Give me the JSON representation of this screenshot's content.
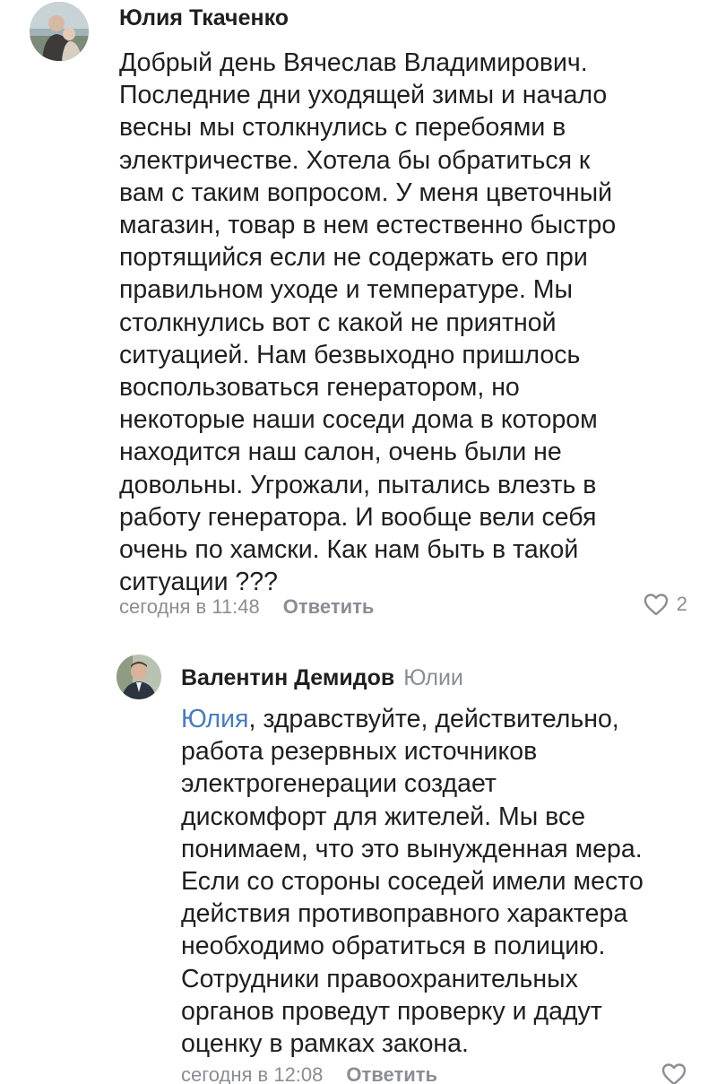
{
  "comment": {
    "author": "Юлия Ткаченко",
    "lines": [
      "Добрый день Вячеслав Владимирович.",
      "Последние дни уходящей зимы и начало",
      "весны мы столкнулись с перебоями в",
      "электричестве. Хотела бы обратиться к",
      "вам с таким вопросом. У меня цветочный",
      "магазин, товар в нем естественно быстро",
      "портящийся если не содержать его при",
      "правильном уходе и температуре. Мы",
      "столкнулись вот с какой не приятной",
      "ситуацией. Нам безвыходно пришлось",
      "воспользоваться генератором, но",
      "некоторые наши соседи дома в котором",
      "находится наш салон, очень были не",
      "довольны. Угрожали, пытались влезть в",
      "работу генератора. И вообще вели себя",
      "очень по хамски. Как нам быть в такой",
      "ситуации ???"
    ],
    "time": "сегодня в 11:48",
    "reply_label": "Ответить",
    "likes": "2",
    "icons": {
      "like": "heart-icon"
    }
  },
  "reply": {
    "author": "Валентин Демидов",
    "reply_to": "Юлии",
    "mention": "Юлия",
    "first_line_rest": ", здравствуйте, действительно,",
    "lines": [
      "работа резервных источников",
      "электрогенерации создает",
      "дискомфорт для жителей. Мы все",
      "понимаем, что это вынужденная мера.",
      "Если со стороны соседей имели место",
      "действия противоправного характера",
      "необходимо обратиться в полицию.",
      "Сотрудники правоохранительных",
      "органов проведут проверку и дадут",
      "оценку в рамках закона."
    ],
    "time": "сегодня в 12:08",
    "reply_label": "Ответить",
    "icons": {
      "like": "heart-icon"
    }
  },
  "colors": {
    "text": "#1f1f1f",
    "muted": "#8a8e94",
    "mention": "#4a7cb8"
  }
}
